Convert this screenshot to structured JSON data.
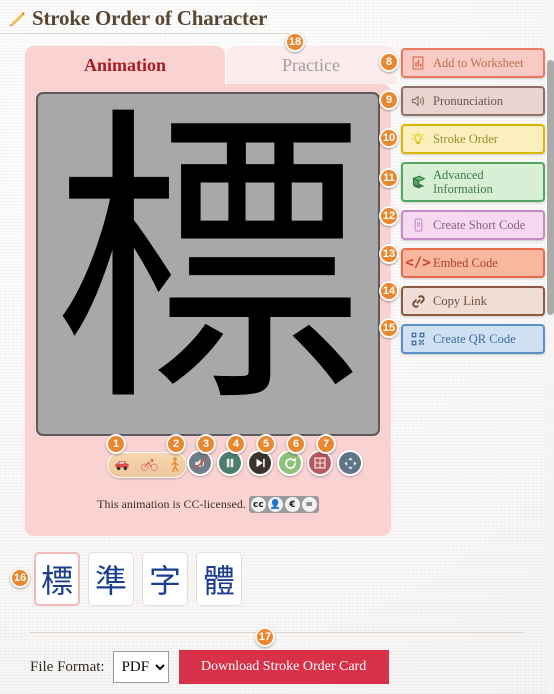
{
  "page": {
    "title": "Stroke Order of Character",
    "title_icon": "pencil-icon"
  },
  "tabs": [
    {
      "label": "Animation",
      "active": true,
      "badge": null
    },
    {
      "label": "Practice",
      "active": false,
      "badge": "18"
    }
  ],
  "animation": {
    "character": "標",
    "canvas_background": "#a8a8a8",
    "license_text": "This animation is CC-licensed.",
    "license_badge": {
      "name": "cc-by-nc-nd-badge",
      "parts": [
        "cc",
        "BY",
        "NC",
        "ND"
      ]
    },
    "controls": [
      {
        "badge": "1",
        "name": "speed-control",
        "icons": [
          "car-icon",
          "bicycle-icon",
          "walking-icon"
        ]
      },
      {
        "badge": "2",
        "name": "mute-button",
        "icon": "speaker-mute-icon",
        "color": "#6e7d86"
      },
      {
        "badge": "3",
        "name": "pause-button",
        "icon": "pause-icon",
        "color": "#4e7d70"
      },
      {
        "badge": "4",
        "name": "step-forward-button",
        "icon": "step-forward-icon",
        "color": "#3c332c"
      },
      {
        "badge": "5",
        "name": "replay-button",
        "icon": "replay-icon",
        "color": "#8ec07a"
      },
      {
        "badge": "6",
        "name": "grid-toggle-button",
        "icon": "grid-icon",
        "color": "#b9585c"
      },
      {
        "badge": "7",
        "name": "fullscreen-button",
        "icon": "fullscreen-icon",
        "color": "#5f7487"
      }
    ]
  },
  "side_actions": [
    {
      "badge": "8",
      "label": "Add to Worksheet",
      "icon": "worksheet-icon",
      "accent": "#ec7a60"
    },
    {
      "badge": "9",
      "label": "Pronunciation",
      "icon": "speaker-icon",
      "accent": "#8c6f66"
    },
    {
      "badge": "10",
      "label": "Stroke Order",
      "icon": "lightbulb-icon",
      "accent": "#d9b800"
    },
    {
      "badge": "11",
      "label": "Advanced Information",
      "icon": "book-icon",
      "accent": "#4fa760"
    },
    {
      "badge": "12",
      "label": "Create Short Code",
      "icon": "mobile-icon",
      "accent": "#c58bc4"
    },
    {
      "badge": "13",
      "label": "Embed Code",
      "icon": "code-icon",
      "accent": "#ea6b4c"
    },
    {
      "badge": "14",
      "label": "Copy Link",
      "icon": "link-icon",
      "accent": "#8a5a42"
    },
    {
      "badge": "15",
      "label": "Create QR Code",
      "icon": "qrcode-icon",
      "accent": "#5b8fc9"
    }
  ],
  "character_thumbnails": {
    "badge": "16",
    "items": [
      {
        "char": "標",
        "selected": true
      },
      {
        "char": "準",
        "selected": false
      },
      {
        "char": "字",
        "selected": false
      },
      {
        "char": "體",
        "selected": false
      }
    ]
  },
  "footer": {
    "file_format_label": "File Format:",
    "file_format_value": "PDF",
    "file_format_options": [
      "PDF"
    ],
    "download_label": "Download Stroke Order Card",
    "download_badge": "17",
    "download_color": "#d9304a"
  }
}
